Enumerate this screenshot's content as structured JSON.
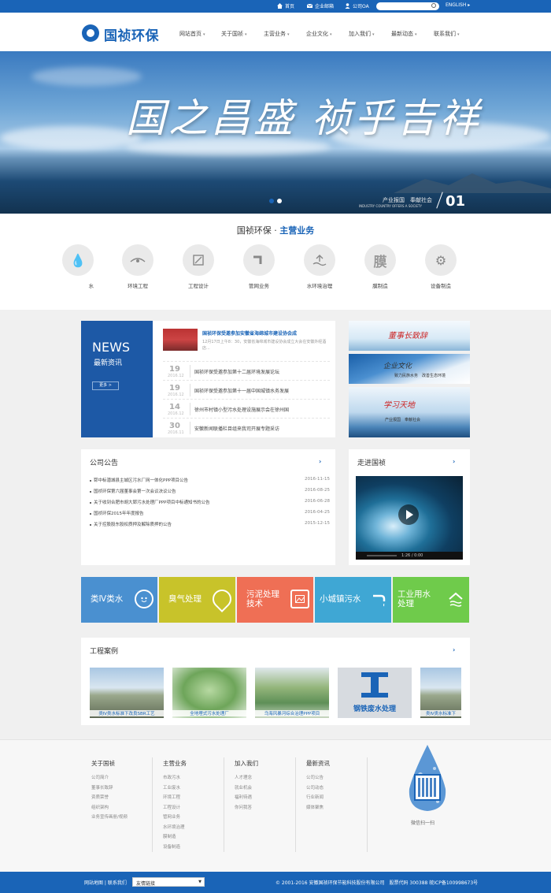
{
  "topbar": {
    "home": "首页",
    "mail": "企业邮箱",
    "oa": "公司OA",
    "search_placeholder": "",
    "lang": "ENGLISH"
  },
  "header": {
    "logo": "国祯环保",
    "nav": [
      "网站首页",
      "关于国祯",
      "主营业务",
      "企业文化",
      "加入我们",
      "最新动态",
      "联系我们"
    ]
  },
  "banner": {
    "slogan": "国之昌盛 祯乎吉祥",
    "caption_cn": "产业报国　奉献社会",
    "caption_en": "INDUSTRY COUNTRY OFFERS A SOCIETY",
    "slide_num": "01"
  },
  "business": {
    "title_prefix": "国祯环保 · ",
    "title_highlight": "主营业务",
    "items": [
      {
        "label": "水",
        "icon": "water-icon"
      },
      {
        "label": "环境工程",
        "icon": "environment-engineering-icon"
      },
      {
        "label": "工程设计",
        "icon": "engineering-design-icon"
      },
      {
        "label": "管网业务",
        "icon": "pipe-network-icon"
      },
      {
        "label": "水环境治理",
        "icon": "water-environment-icon"
      },
      {
        "label": "膜制造",
        "icon": "membrane-icon",
        "glyph": "膜"
      },
      {
        "label": "设备制造",
        "icon": "gear-icon"
      }
    ]
  },
  "news": {
    "en": "NEWS",
    "cn": "最新资讯",
    "more": "更多 >",
    "headline": "国祯环保受邀参加安徽省海绵城市建设协会成",
    "summary": "12月17日上午8：30，安徽省海绵城市建设协会成立大会在安徽外经酒店...",
    "items": [
      {
        "day": "19",
        "ym": "2016.12",
        "title": "国祯环保受邀参加第十二届环境发展论坛"
      },
      {
        "day": "19",
        "ym": "2016.12",
        "title": "国祯环保受邀参加第十一届中国城镇水务发展"
      },
      {
        "day": "14",
        "ym": "2016.12",
        "title": "徐州市村镇小型污水处理设施展示会在徐州国"
      },
      {
        "day": "30",
        "ym": "2016.11",
        "title": "安徽新闻联播栏目组来我司开展专题采访"
      }
    ]
  },
  "side_banners": [
    {
      "title": "董事长致辞",
      "sub": ""
    },
    {
      "title": "企业文化",
      "sub": "致力民族水务　改善生态环境"
    },
    {
      "title": "学习天地",
      "sub": "产业报国　奉献社会"
    }
  ],
  "announcements": {
    "title": "公司公告",
    "arrow": "›",
    "items": [
      {
        "text": "郓中标潜城县主城区污水厂网一体化PPP项目公告",
        "date": "2016-11-15"
      },
      {
        "text": "国祯环保第六届董事会第一次会议决议公告",
        "date": "2016-08-25"
      },
      {
        "text": "关于收到合肥市胡大郢污水处理厂PPP项目中标通知书的公告",
        "date": "2016-06-28"
      },
      {
        "text": "国祯环保2015年年度报告",
        "date": "2016-04-25"
      },
      {
        "text": "关于控股股东股权质押及解除质押的公告",
        "date": "2015-12-15"
      }
    ]
  },
  "about": {
    "title": "走进国祯",
    "arrow": "›",
    "video_time": "1:26 / 0:00"
  },
  "tiles": [
    {
      "label": "类Ⅳ类水",
      "color": "#4a90d0",
      "icon": "face-icon"
    },
    {
      "label": "臭气处理",
      "color": "#c8c32a",
      "icon": "location-pin-icon"
    },
    {
      "label": "污泥处理\n技术",
      "color": "#ef6f55",
      "icon": "image-icon"
    },
    {
      "label": "小城镇污水",
      "color": "#3fa7d4",
      "icon": "faucet-icon"
    },
    {
      "label": "工业用水\n处理",
      "color": "#6fcb4b",
      "icon": "house-water-icon"
    }
  ],
  "projects": {
    "title": "工程案例",
    "arrow": "›",
    "items": [
      {
        "caption": "类Ⅳ类水标准下改良SBR工艺"
      },
      {
        "caption": "全地埋式污水处理厂"
      },
      {
        "caption": "乌海风暴河综合治理PPP项目"
      },
      {
        "caption": "钢铁废水处理"
      },
      {
        "caption": "类Ⅳ类水标准下"
      }
    ]
  },
  "footer": {
    "columns": [
      {
        "title": "关于国祯",
        "links": [
          "公司简介",
          "董事长致辞",
          "资质荣誉",
          "组织架构",
          "业务宣传画册/视频"
        ]
      },
      {
        "title": "主营业务",
        "links": [
          "市政污水",
          "工业废水",
          "环境工程",
          "工程设计",
          "管网业务",
          "水环境治理",
          "膜制造",
          "设备制造"
        ]
      },
      {
        "title": "加入我们",
        "links": [
          "人才理念",
          "就业机会",
          "福利待遇",
          "你问我答"
        ]
      },
      {
        "title": "最新资讯",
        "links": [
          "公司公告",
          "公司动态",
          "行业新闻",
          "媒体聚焦"
        ]
      }
    ],
    "qr_caption": "微信扫一扫"
  },
  "bottombar": {
    "links": "网站地图 | 联系我们",
    "select_value": "友情链接",
    "copyright": "© 2001-2016 安徽国祯环保节能科技股份有限公司　股票代码 300388 皖ICP备100998673号"
  },
  "colors": {
    "brand_blue": "#1a64b7",
    "news_blue": "#1d59a6",
    "grey_bg": "#f0f0f0"
  }
}
